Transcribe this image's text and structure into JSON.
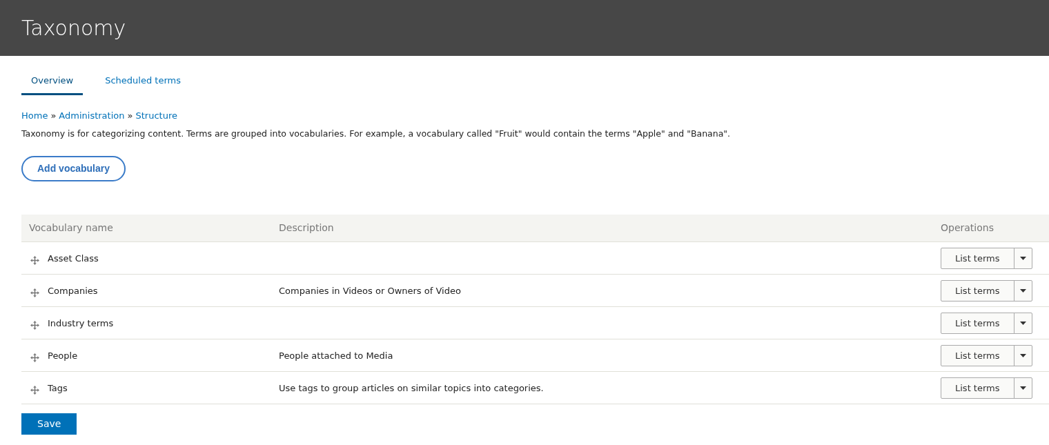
{
  "page_title": "Taxonomy",
  "tabs": [
    {
      "label": "Overview",
      "selected": true
    },
    {
      "label": "Scheduled terms",
      "selected": false
    }
  ],
  "breadcrumb": [
    "Home",
    "Administration",
    "Structure"
  ],
  "breadcrumb_separator": "»",
  "intro": "Taxonomy is for categorizing content. Terms are grouped into vocabularies. For example, a vocabulary called \"Fruit\" would contain the terms \"Apple\" and \"Banana\".",
  "add_button": "Add vocabulary",
  "table": {
    "columns": [
      "Vocabulary name",
      "Description",
      "Operations"
    ],
    "rows": [
      {
        "name": "Asset Class",
        "description": "",
        "operation": "List terms"
      },
      {
        "name": "Companies",
        "description": "Companies in Videos or Owners of Video",
        "operation": "List terms"
      },
      {
        "name": "Industry terms",
        "description": "",
        "operation": "List terms"
      },
      {
        "name": "People",
        "description": "People attached to Media",
        "operation": "List terms"
      },
      {
        "name": "Tags",
        "description": "Use tags to group articles on similar topics into categories.",
        "operation": "List terms"
      }
    ]
  },
  "save_button": "Save"
}
